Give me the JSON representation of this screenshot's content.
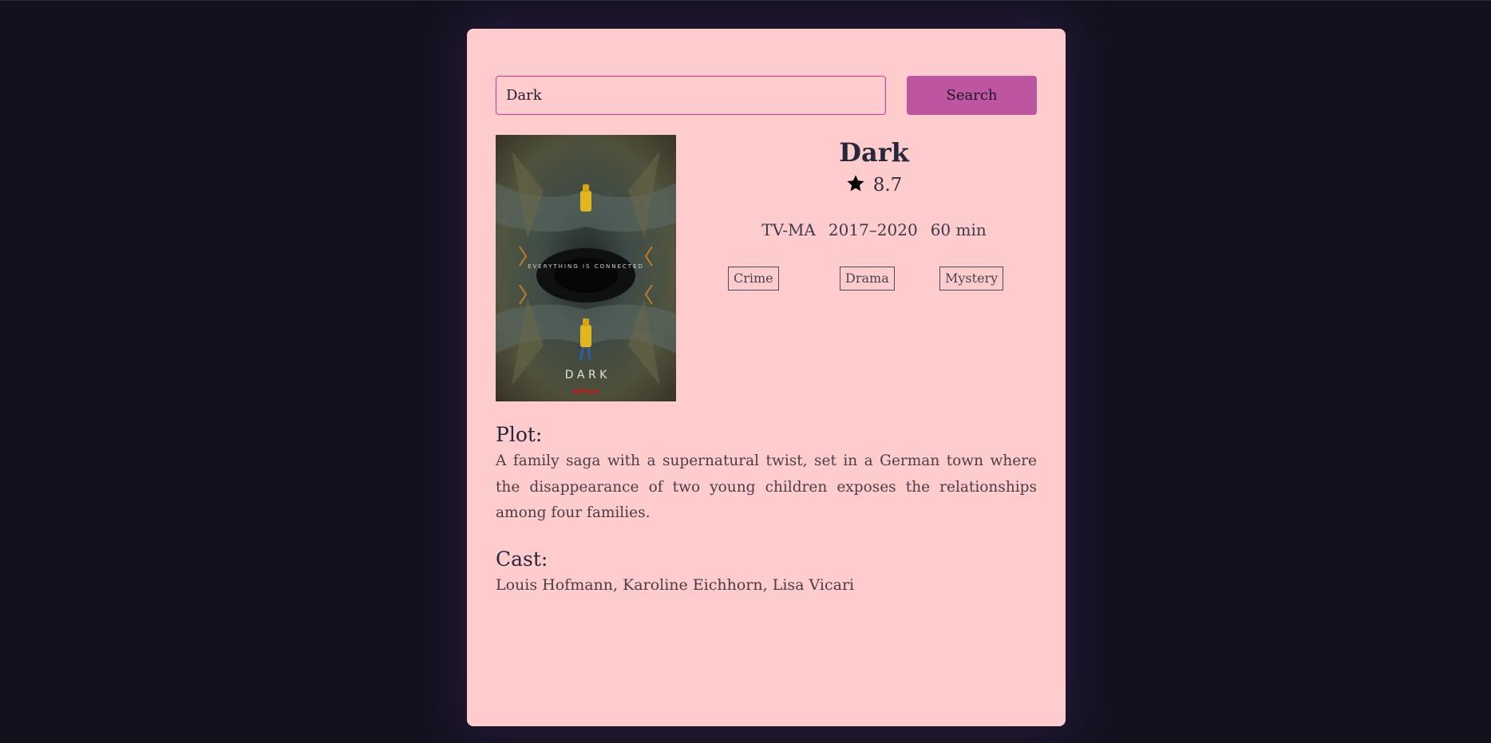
{
  "search": {
    "value": "Dark",
    "button_label": "Search"
  },
  "show": {
    "title": "Dark",
    "rating": "8.7",
    "content_rating": "TV-MA",
    "years": "2017–2020",
    "runtime": "60 min",
    "genres": [
      "Crime",
      "Drama",
      "Mystery"
    ],
    "poster": {
      "tagline": "EVERYTHING IS CONNECTED",
      "title": "D A R K",
      "network": "NETFLIX"
    }
  },
  "plot": {
    "heading": "Plot:",
    "text": "A family saga with a supernatural twist, set in a German town where the disappearance of two young children exposes the relationships among four families."
  },
  "cast": {
    "heading": "Cast:",
    "text": "Louis Hofmann, Karoline Eichhorn, Lisa Vicari"
  },
  "colors": {
    "page_bg": "#12121f",
    "card_bg": "#ffcccd",
    "accent": "#bd55a1",
    "input_border": "#e4309a",
    "star": "#000000"
  },
  "icons": {
    "rating": "star-icon"
  }
}
